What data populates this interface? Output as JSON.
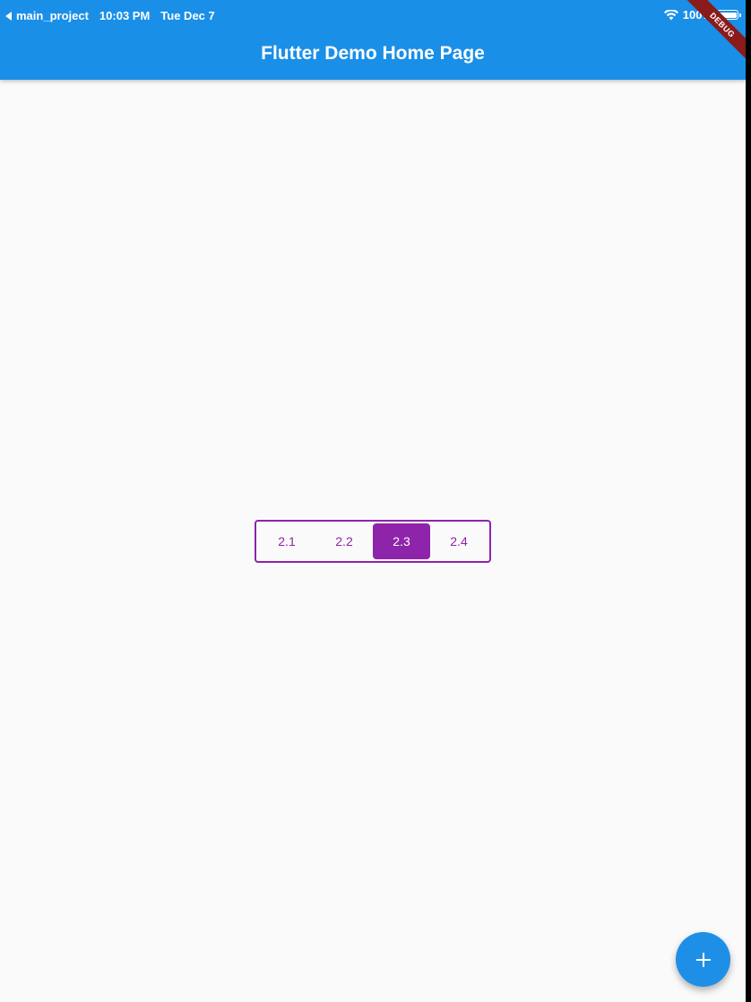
{
  "status_bar": {
    "back_app": "main_project",
    "time": "10:03 PM",
    "date": "Tue Dec 7",
    "battery_percent": "100%"
  },
  "app_bar": {
    "title": "Flutter Demo Home Page"
  },
  "debug_banner": {
    "label": "DEBUG"
  },
  "toggle_buttons": {
    "selected": "2.3",
    "items": [
      {
        "label": "2.1"
      },
      {
        "label": "2.2"
      },
      {
        "label": "2.3"
      },
      {
        "label": "2.4"
      }
    ]
  },
  "fab": {
    "icon": "plus-icon"
  },
  "colors": {
    "app_bar": "#1a8fe8",
    "accent": "#8e24aa",
    "fab": "#1e8fe7",
    "background": "#fafafa"
  }
}
